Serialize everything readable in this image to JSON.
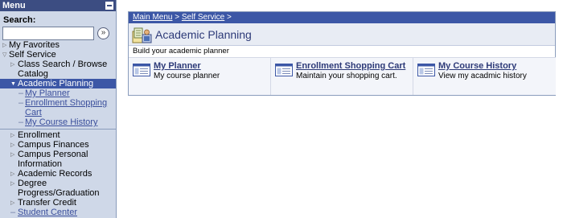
{
  "menu": {
    "title": "Menu",
    "search_label": "Search:",
    "search_value": "",
    "go_glyph": "»",
    "items": [
      {
        "label": "My Favorites"
      },
      {
        "label": "Self Service"
      },
      {
        "label": "Class Search / Browse Catalog"
      },
      {
        "label": "Academic Planning"
      },
      {
        "label": "My Planner"
      },
      {
        "label": "Enrollment Shopping Cart"
      },
      {
        "label": "My Course History"
      },
      {
        "label": "Enrollment"
      },
      {
        "label": "Campus Finances"
      },
      {
        "label": "Campus Personal Information"
      },
      {
        "label": "Academic Records"
      },
      {
        "label": "Degree Progress/Graduation"
      },
      {
        "label": "Transfer Credit"
      },
      {
        "label": "Student Center"
      }
    ]
  },
  "breadcrumb": {
    "main_menu": "Main Menu",
    "sep1": " > ",
    "self_service": "Self Service",
    "sep2": " >"
  },
  "page": {
    "title": "Academic Planning",
    "subtitle": "Build your academic planner"
  },
  "tiles": [
    {
      "link": "My Planner",
      "desc": "My course planner"
    },
    {
      "link": "Enrollment Shopping Cart",
      "desc": "Maintain your shopping cart."
    },
    {
      "link": "My Course History",
      "desc": "View my acadmic history"
    }
  ],
  "colors": {
    "menu_header": "#3c4d82",
    "menu_bg": "#cfd8e8",
    "selected": "#3c57a6",
    "link": "#2d3a78"
  }
}
